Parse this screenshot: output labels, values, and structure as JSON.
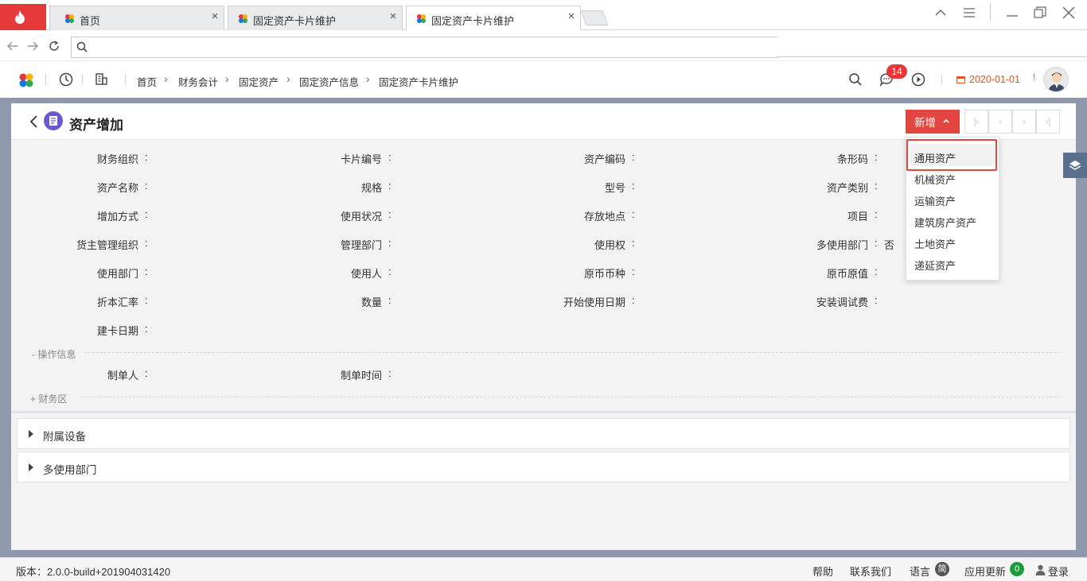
{
  "browser": {
    "tabs": [
      {
        "title": "首页"
      },
      {
        "title": "固定资产卡片维护"
      },
      {
        "title": "固定资产卡片维护"
      }
    ],
    "url": ""
  },
  "header": {
    "breadcrumb": [
      "首页",
      "财务会计",
      "固定资产",
      "固定资产信息",
      "固定资产卡片维护"
    ],
    "message_count": "14",
    "date": "2020-01-01",
    "warning": "!"
  },
  "page": {
    "title": "资产增加",
    "add_button": "新增",
    "pager": [
      "|‹",
      "‹",
      "›",
      "›|"
    ]
  },
  "form": {
    "rows": [
      [
        "财务组织",
        "卡片编号",
        "资产编码",
        "条形码"
      ],
      [
        "资产名称",
        "规格",
        "型号",
        "资产类别"
      ],
      [
        "增加方式",
        "使用状况",
        "存放地点",
        "项目"
      ],
      [
        "货主管理组织",
        "管理部门",
        "使用权",
        "多使用部门"
      ],
      [
        "使用部门",
        "使用人",
        "原币币种",
        "原币原值"
      ],
      [
        "折本汇率",
        "数量",
        "开始使用日期",
        "安装调试费"
      ],
      [
        "建卡日期"
      ]
    ],
    "multi_dept_value": "否",
    "operation_section": "- 操作信息",
    "operation_rows": [
      [
        "制单人",
        "制单时间"
      ]
    ],
    "finance_section": "+ 财务区"
  },
  "collapsibles": [
    "附属设备",
    "多使用部门"
  ],
  "dropdown": {
    "items": [
      "通用资产",
      "机械资产",
      "运输资产",
      "建筑房产资产",
      "土地资产",
      "递延资产"
    ]
  },
  "status": {
    "version": "版本：2.0.0-build+201904031420",
    "help": "帮助",
    "contact": "联系我们",
    "language": "语言",
    "language_badge": "简",
    "update": "应用更新",
    "update_count": "0",
    "login": "登录"
  },
  "colors": {
    "accent": "#e3453f",
    "date": "#e0541f",
    "badge_green": "#1a9c3b"
  }
}
